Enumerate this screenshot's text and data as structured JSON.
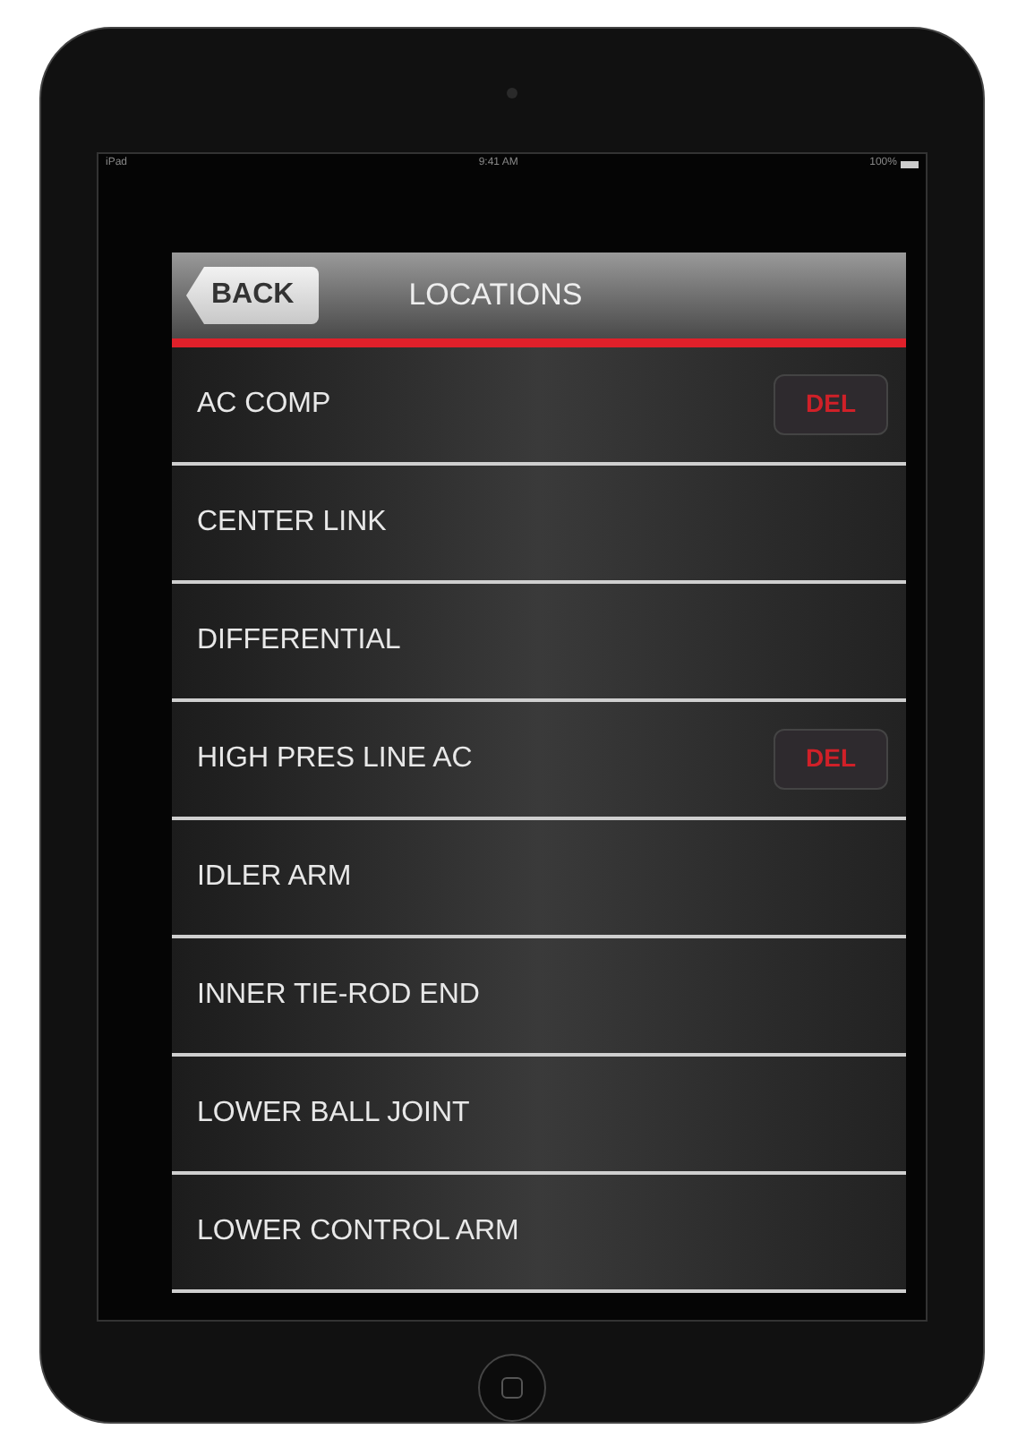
{
  "status_bar": {
    "carrier": "iPad",
    "time": "9:41 AM",
    "battery": "100%"
  },
  "nav_bar": {
    "back": "BACK",
    "title": "LOCATIONS"
  },
  "locations": [
    {
      "label": "AC COMP",
      "delete_button": "DEL"
    },
    {
      "label": "CENTER LINK"
    },
    {
      "label": "DIFFERENTIAL"
    },
    {
      "label": "HIGH PRES LINE AC",
      "delete_button": "DEL"
    },
    {
      "label": "IDLER ARM"
    },
    {
      "label": "INNER TIE-ROD END"
    },
    {
      "label": "LOWER BALL JOINT"
    },
    {
      "label": "LOWER CONTROL ARM"
    }
  ]
}
